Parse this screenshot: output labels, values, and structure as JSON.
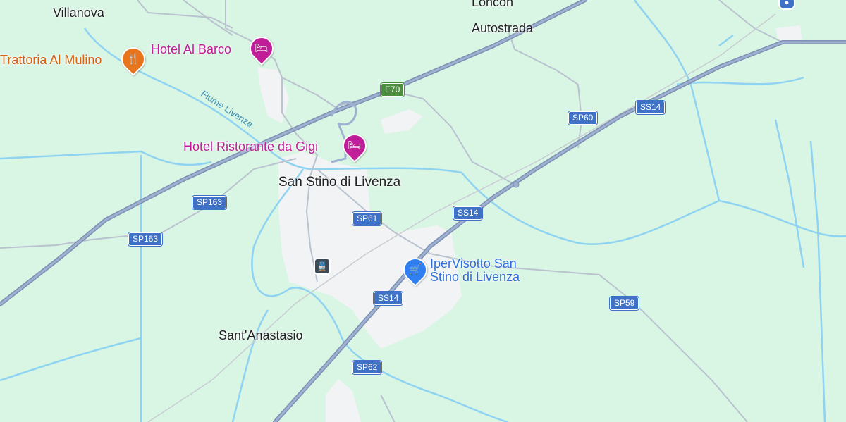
{
  "places": {
    "villanova": "Villanova",
    "loncon": "Loncon",
    "autostrada": "Autostrada",
    "san_stino": "San Stino di Livenza",
    "santanastasio": "Sant'Anastasio"
  },
  "pois": {
    "hotel_barco": "Hotel Al Barco",
    "trattoria": "Trattoria Al Mulino",
    "hotel_gigi": "Hotel Ristorante da Gigi",
    "ipervisotto": "IperVisotto San Stino di Livenza"
  },
  "water": {
    "fiume": "Fiume Livenza"
  },
  "roads": {
    "e70": "E70",
    "sp60": "SP60",
    "ss14_a": "SS14",
    "ss14_b": "SS14",
    "ss14_c": "SS14",
    "sp163_a": "SP163",
    "sp163_b": "SP163",
    "sp61": "SP61",
    "sp59": "SP59",
    "sp62": "SP62"
  },
  "icons": {
    "hotel": "bed-icon",
    "restaurant": "fork-knife-icon",
    "shopping": "shopping-cart-icon",
    "station": "train-icon"
  },
  "colors": {
    "land": "#d9f5e3",
    "urban": "#f1f3f4",
    "water": "#8fd3f2",
    "highway": "#8ea3c4",
    "hotel": "#c21d98",
    "food": "#d8620e",
    "shop": "#2f6fd9",
    "shield": "#3f71c6",
    "shield_green": "#4b8f3e"
  }
}
